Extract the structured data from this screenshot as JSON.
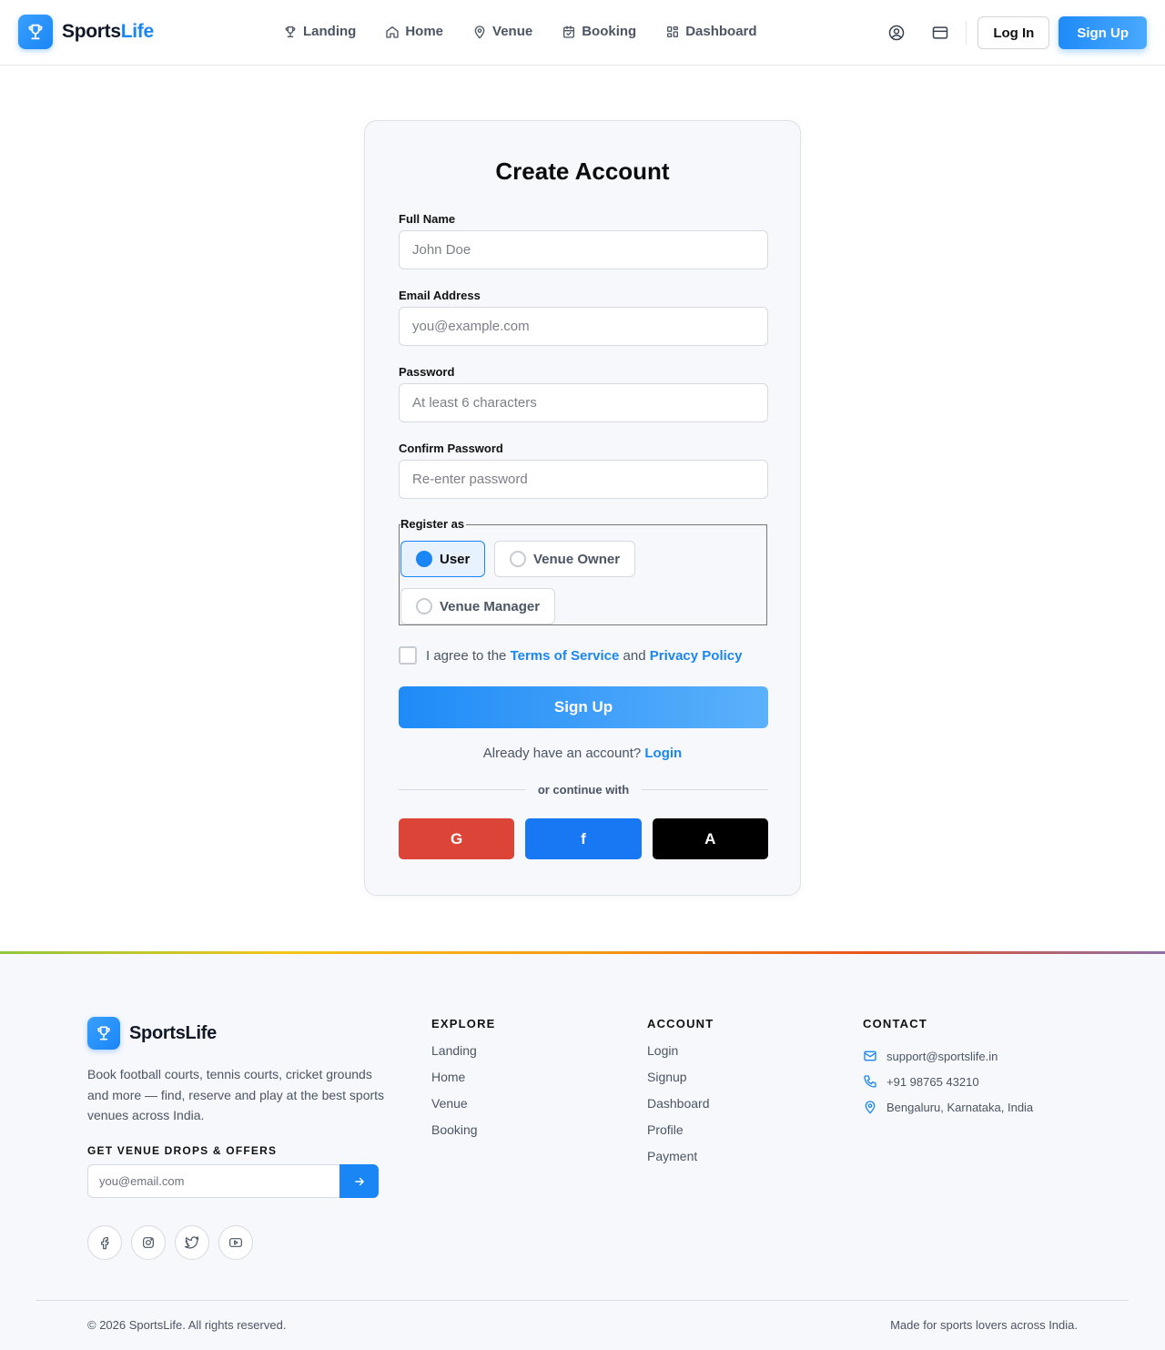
{
  "brand": {
    "name_main": "Sports",
    "name_accent": "Life",
    "footer_name": "SportsLife"
  },
  "nav": [
    {
      "label": "Landing",
      "icon": "trophy-icon"
    },
    {
      "label": "Home",
      "icon": "home-icon"
    },
    {
      "label": "Venue",
      "icon": "map-pin-icon"
    },
    {
      "label": "Booking",
      "icon": "calendar-icon"
    },
    {
      "label": "Dashboard",
      "icon": "dashboard-icon"
    }
  ],
  "header": {
    "login_label": "Log In",
    "signup_label": "Sign Up"
  },
  "form": {
    "title": "Create Account",
    "full_name": {
      "label": "Full Name",
      "placeholder": "John Doe",
      "value": ""
    },
    "email": {
      "label": "Email Address",
      "placeholder": "you@example.com",
      "value": ""
    },
    "password": {
      "label": "Password",
      "placeholder": "At least 6 characters",
      "value": ""
    },
    "confirm": {
      "label": "Confirm Password",
      "placeholder": "Re-enter password",
      "value": ""
    },
    "register_as": {
      "legend": "Register as",
      "options": [
        "User",
        "Venue Owner",
        "Venue Manager"
      ],
      "selected": "User"
    },
    "agree": {
      "prefix": "I agree to the",
      "terms": "Terms of Service",
      "and": "and",
      "privacy": "Privacy Policy",
      "checked": false
    },
    "submit_label": "Sign Up",
    "already": {
      "text": "Already have an account?",
      "link": "Login"
    },
    "divider": "or continue with",
    "socials": [
      {
        "label": "G",
        "color": "#db4437"
      },
      {
        "label": "f",
        "color": "#1877f2"
      },
      {
        "label": "A",
        "color": "#000000"
      }
    ]
  },
  "colors": {
    "accent": "#1a86f5",
    "card_bg": "#f7f8fc"
  },
  "footer": {
    "description": "Book football courts, tennis courts, cricket grounds and more — find, reserve and play at the best sports venues across India.",
    "offers_heading": "GET VENUE DROPS & OFFERS",
    "subscribe_placeholder": "you@email.com",
    "social_icons": [
      "facebook-icon",
      "instagram-icon",
      "twitter-icon",
      "youtube-icon"
    ],
    "explore": {
      "heading": "EXPLORE",
      "links": [
        "Landing",
        "Home",
        "Venue",
        "Booking"
      ]
    },
    "account": {
      "heading": "ACCOUNT",
      "links": [
        "Login",
        "Signup",
        "Dashboard",
        "Profile",
        "Payment"
      ]
    },
    "contact": {
      "heading": "CONTACT",
      "email": "support@sportslife.in",
      "phone": "+91 98765 43210",
      "address": "Bengaluru, Karnataka, India"
    },
    "copyright": "© 2026 SportsLife. All rights reserved.",
    "tagline": "Made for sports lovers across India."
  }
}
